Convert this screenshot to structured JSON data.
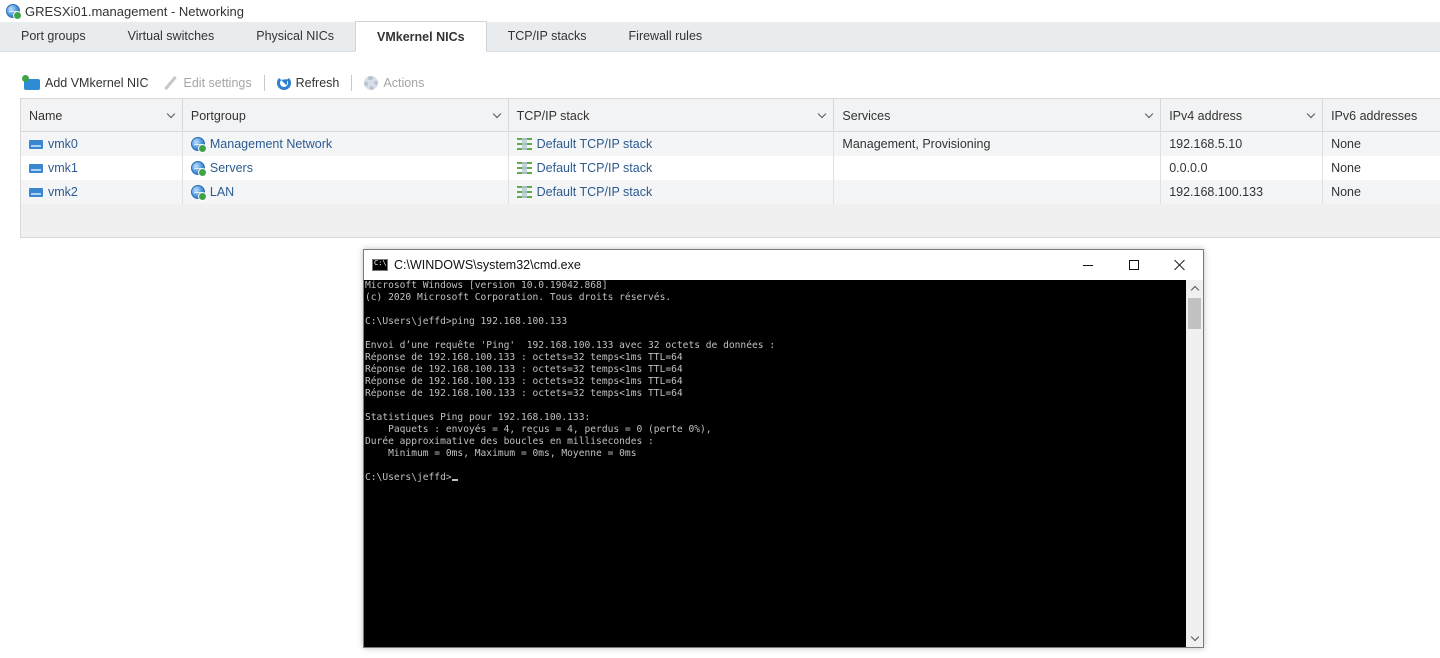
{
  "window": {
    "title": "GRESXi01.management - Networking"
  },
  "tabs": [
    {
      "label": "Port groups"
    },
    {
      "label": "Virtual switches"
    },
    {
      "label": "Physical NICs"
    },
    {
      "label": "VMkernel NICs",
      "active": true
    },
    {
      "label": "TCP/IP stacks"
    },
    {
      "label": "Firewall rules"
    }
  ],
  "toolbar": {
    "add_label": "Add VMkernel NIC",
    "edit_label": "Edit settings",
    "refresh_label": "Refresh",
    "actions_label": "Actions"
  },
  "table": {
    "columns": [
      "Name",
      "Portgroup",
      "TCP/IP stack",
      "Services",
      "IPv4 address",
      "IPv6 addresses"
    ],
    "rows": [
      {
        "name": "vmk0",
        "portgroup": "Management Network",
        "stack": "Default TCP/IP stack",
        "services": "Management, Provisioning",
        "ipv4": "192.168.5.10",
        "ipv6": "None"
      },
      {
        "name": "vmk1",
        "portgroup": "Servers",
        "stack": "Default TCP/IP stack",
        "services": "",
        "ipv4": "0.0.0.0",
        "ipv6": "None"
      },
      {
        "name": "vmk2",
        "portgroup": "LAN",
        "stack": "Default TCP/IP stack",
        "services": "",
        "ipv4": "192.168.100.133",
        "ipv6": "None"
      }
    ]
  },
  "cmd": {
    "title": "C:\\WINDOWS\\system32\\cmd.exe",
    "lines": [
      "Microsoft Windows [version 10.0.19042.868]",
      "(c) 2020 Microsoft Corporation. Tous droits réservés.",
      "",
      "C:\\Users\\jeffd>ping 192.168.100.133",
      "",
      "Envoi d’une requête 'Ping'  192.168.100.133 avec 32 octets de données :",
      "Réponse de 192.168.100.133 : octets=32 temps<1ms TTL=64",
      "Réponse de 192.168.100.133 : octets=32 temps<1ms TTL=64",
      "Réponse de 192.168.100.133 : octets=32 temps<1ms TTL=64",
      "Réponse de 192.168.100.133 : octets=32 temps<1ms TTL=64",
      "",
      "Statistiques Ping pour 192.168.100.133:",
      "    Paquets : envoyés = 4, reçus = 4, perdus = 0 (perte 0%),",
      "Durée approximative des boucles en millisecondes :",
      "    Minimum = 0ms, Maximum = 0ms, Moyenne = 0ms",
      ""
    ],
    "prompt": "C:\\Users\\jeffd>"
  },
  "icons": {
    "app": "globe-icon",
    "add": "add-nic-icon",
    "edit": "pencil-icon",
    "refresh": "refresh-icon",
    "actions": "gear-icon",
    "nic": "vmkernel-nic-icon",
    "portgroup": "portgroup-globe-icon",
    "stack": "tcpip-stack-icon"
  }
}
